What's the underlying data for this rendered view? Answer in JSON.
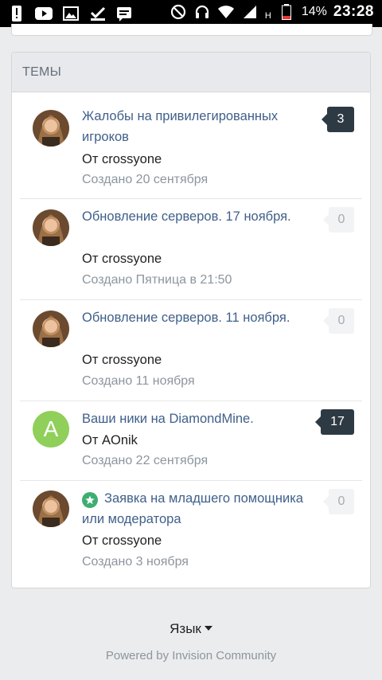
{
  "status_bar": {
    "icons_left": [
      "alert-icon",
      "youtube-icon",
      "image-icon",
      "checklist-icon",
      "chat-icon"
    ],
    "icons_right": [
      "no-disturb-icon",
      "headset-icon",
      "wifi-icon",
      "signal-icon",
      "battery-icon"
    ],
    "network": "H",
    "battery": "14%",
    "time": "23:28"
  },
  "topics_card": {
    "title": "ТЕМЫ",
    "items": [
      {
        "title": "Жалобы на привилегированных игроков",
        "author": "От crossyone",
        "date": "Создано 20 сентября",
        "replies": "3",
        "avatar": "photo",
        "pinned": false
      },
      {
        "title": "Обновление серверов. 17 ноября.",
        "author": "От crossyone",
        "date": "Создано Пятница в 21:50",
        "replies": "0",
        "avatar": "photo",
        "pinned": false
      },
      {
        "title": "Обновление серверов. 11 ноября.",
        "author": "От crossyone",
        "date": "Создано 11 ноября",
        "replies": "0",
        "avatar": "photo",
        "pinned": false
      },
      {
        "title": "Ваши ники на DiamondMine.",
        "author": "От AOnik",
        "date": "Создано 22 сентября",
        "replies": "17",
        "avatar": "A",
        "pinned": false
      },
      {
        "title": "Заявка на младшего помощника или модератора",
        "author": "От crossyone",
        "date": "Создано 3 ноября",
        "replies": "0",
        "avatar": "photo",
        "pinned": true
      }
    ]
  },
  "footer": {
    "language": "Язык",
    "powered_by": "Powered by Invision Community"
  },
  "colors": {
    "link": "#3f5f8a",
    "badge_dark": "#2e3a43",
    "header_bg": "#e7e9ec",
    "avatar_green": "#8fcf5a",
    "star_green": "#3eae70"
  }
}
